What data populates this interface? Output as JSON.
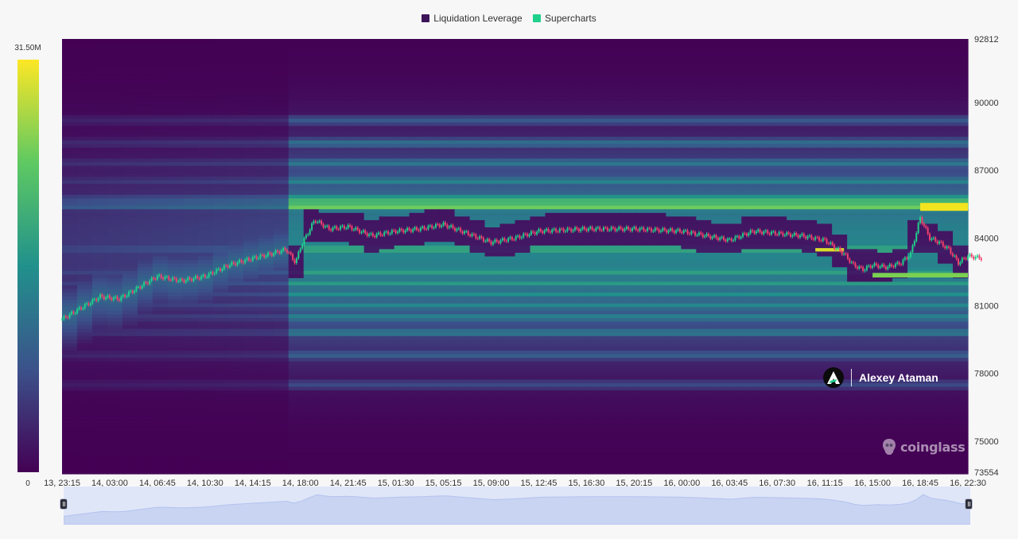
{
  "legend": {
    "items": [
      {
        "label": "Liquidation Leverage",
        "color": "#3d1359"
      },
      {
        "label": "Supercharts",
        "color": "#1fd18b"
      }
    ]
  },
  "colorbar": {
    "max_label": "31.50M",
    "min_label": "0",
    "colors": [
      "#440154",
      "#3b528b",
      "#21918c",
      "#5ec962",
      "#fde725"
    ]
  },
  "watermark": {
    "name": "Alexey Ataman"
  },
  "brand": {
    "name": "coinglass"
  },
  "chart_data": {
    "type": "heatmap",
    "y_axis": {
      "min_label": "73554",
      "max_label": "92812",
      "ticks": [
        "90000",
        "87000",
        "84000",
        "81000",
        "78000",
        "75000"
      ],
      "range": [
        73554,
        92812
      ]
    },
    "x_axis": {
      "ticks": [
        "13, 23:15",
        "14, 03:00",
        "14, 06:45",
        "14, 10:30",
        "14, 14:15",
        "14, 18:00",
        "14, 21:45",
        "15, 01:30",
        "15, 05:15",
        "15, 09:00",
        "15, 12:45",
        "15, 16:30",
        "15, 20:15",
        "16, 00:00",
        "16, 03:45",
        "16, 07:30",
        "16, 11:15",
        "16, 15:00",
        "16, 18:45",
        "16, 22:30"
      ]
    },
    "price_path": {
      "x_index": [
        0,
        0.4,
        0.8,
        1.2,
        1.6,
        2.0,
        2.5,
        3.0,
        3.5,
        4.0,
        4.4,
        4.7,
        4.9,
        5.0,
        5.3,
        5.6,
        6.0,
        6.5,
        7.0,
        7.5,
        8.0,
        8.5,
        9.0,
        9.5,
        10.0,
        11.0,
        12.0,
        13.0,
        14.0,
        14.5,
        15.0,
        15.5,
        16.0,
        16.4,
        16.6,
        16.8,
        17.0,
        17.3,
        17.6,
        17.8,
        18.0,
        18.2,
        18.4,
        18.6,
        18.8,
        19.0,
        19.3
      ],
      "price": [
        80400,
        80900,
        81400,
        81300,
        81800,
        82300,
        82100,
        82300,
        82800,
        83100,
        83300,
        83500,
        82900,
        83600,
        84800,
        84400,
        84500,
        84100,
        84300,
        84400,
        84600,
        84200,
        83800,
        84000,
        84300,
        84400,
        84400,
        84300,
        83900,
        84300,
        84200,
        84100,
        83900,
        83300,
        82800,
        82600,
        82800,
        82700,
        82900,
        83300,
        84900,
        84000,
        83800,
        83500,
        82900,
        83200,
        83100
      ]
    },
    "liquidation_bands": [
      {
        "price": 85400,
        "intensity": 1.0
      },
      {
        "price": 85700,
        "intensity": 0.82
      },
      {
        "price": 83500,
        "intensity": 0.78
      },
      {
        "price": 82500,
        "intensity": 0.72
      },
      {
        "price": 82000,
        "intensity": 0.68
      },
      {
        "price": 81500,
        "intensity": 0.62
      },
      {
        "price": 81000,
        "intensity": 0.58
      },
      {
        "price": 80500,
        "intensity": 0.55
      },
      {
        "price": 79800,
        "intensity": 0.5
      },
      {
        "price": 86500,
        "intensity": 0.55
      },
      {
        "price": 87300,
        "intensity": 0.5
      },
      {
        "price": 88200,
        "intensity": 0.45
      },
      {
        "price": 89200,
        "intensity": 0.35
      },
      {
        "price": 78800,
        "intensity": 0.38
      },
      {
        "price": 77500,
        "intensity": 0.28
      }
    ]
  }
}
